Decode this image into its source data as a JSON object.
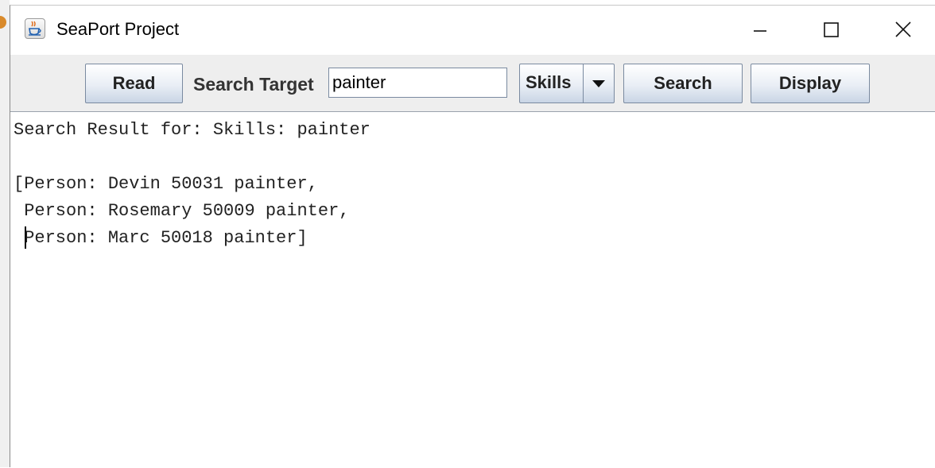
{
  "window": {
    "title": "SeaPort Project"
  },
  "titlebar": {
    "icons": {
      "app": "java-cup-icon",
      "minimize": "minimize-icon",
      "maximize": "maximize-icon",
      "close": "close-icon"
    }
  },
  "toolbar": {
    "read_label": "Read",
    "search_target_label": "Search Target",
    "search_input_value": "painter",
    "search_type_selected": "Skills",
    "search_label": "Search",
    "display_label": "Display"
  },
  "output": {
    "lines": [
      "Search Result for: Skills: painter",
      "",
      "[Person: Devin 50031 painter,",
      " Person: Rosemary 50009 painter,",
      " Person: Marc 50018 painter]"
    ]
  }
}
